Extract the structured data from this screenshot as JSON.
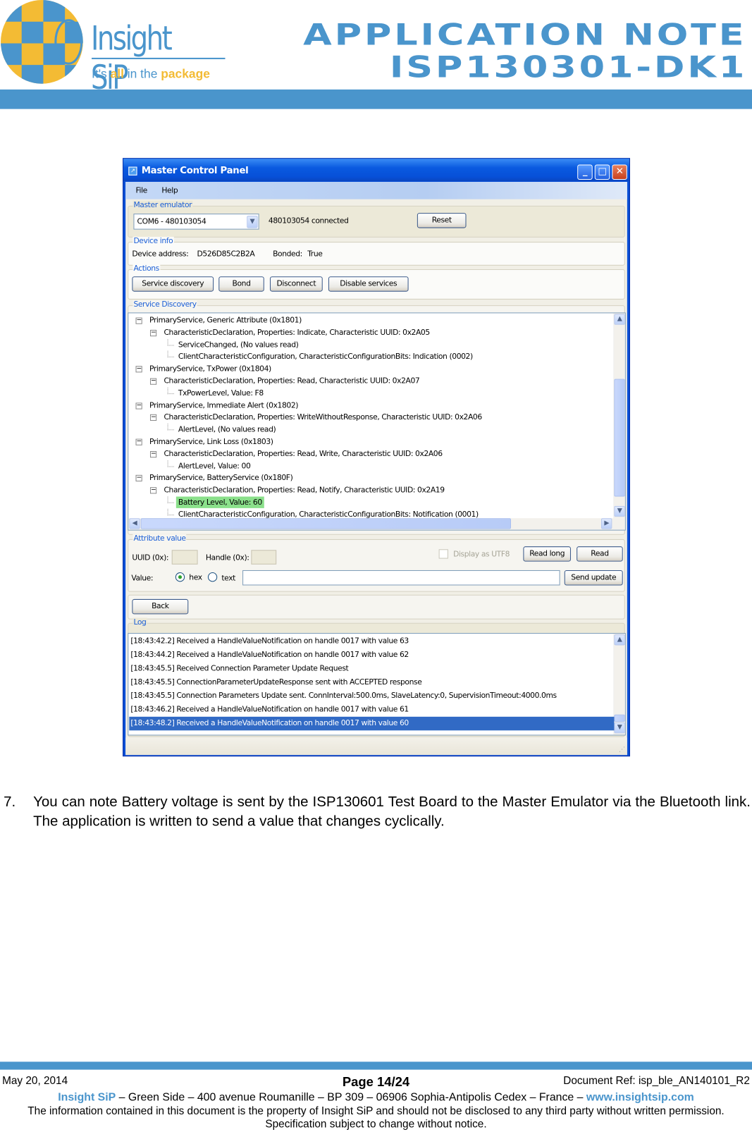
{
  "header": {
    "logo_text": "Insight SiP",
    "logo_tagline": [
      "It's ",
      "all",
      " in the ",
      "package"
    ],
    "title_line1": "APPLICATION NOTE",
    "title_line2": "ISP130301-DK1",
    "brand_color": "#4a95cc"
  },
  "window": {
    "title": "Master Control Panel",
    "controls": [
      "minimize",
      "maximize",
      "close"
    ],
    "menu": [
      "File",
      "Help"
    ],
    "master_emulator": {
      "label": "Master emulator",
      "com_port": "COM6 - 480103054",
      "status": "480103054 connected",
      "reset_label": "Reset"
    },
    "device_info": {
      "label": "Device info",
      "address_label": "Device address:",
      "address": "D526D85C2B2A",
      "bonded_label": "Bonded:",
      "bonded": "True"
    },
    "actions": {
      "label": "Actions",
      "buttons": [
        "Service discovery",
        "Bond",
        "Disconnect",
        "Disable services"
      ]
    },
    "service_discovery": {
      "label": "Service Discovery",
      "tree": [
        {
          "level": 0,
          "text": "PrimaryService, Generic Attribute (0x1801)"
        },
        {
          "level": 1,
          "text": "CharacteristicDeclaration, Properties: Indicate, Characteristic UUID: 0x2A05"
        },
        {
          "level": 2,
          "text": "ServiceChanged, (No values read)"
        },
        {
          "level": 2,
          "text": "ClientCharacteristicConfiguration, CharacteristicConfigurationBits: Indication (0002)"
        },
        {
          "level": 0,
          "text": "PrimaryService, TxPower (0x1804)"
        },
        {
          "level": 1,
          "text": "CharacteristicDeclaration, Properties: Read, Characteristic UUID: 0x2A07"
        },
        {
          "level": 2,
          "text": "TxPowerLevel, Value: F8"
        },
        {
          "level": 0,
          "text": "PrimaryService, Immediate Alert (0x1802)"
        },
        {
          "level": 1,
          "text": "CharacteristicDeclaration, Properties: WriteWithoutResponse, Characteristic UUID: 0x2A06"
        },
        {
          "level": 2,
          "text": "AlertLevel, (No values read)"
        },
        {
          "level": 0,
          "text": "PrimaryService, Link Loss (0x1803)"
        },
        {
          "level": 1,
          "text": "CharacteristicDeclaration, Properties: Read, Write, Characteristic UUID: 0x2A06"
        },
        {
          "level": 2,
          "text": "AlertLevel, Value: 00"
        },
        {
          "level": 0,
          "text": "PrimaryService, BatteryService (0x180F)"
        },
        {
          "level": 1,
          "text": "CharacteristicDeclaration, Properties: Read, Notify, Characteristic UUID: 0x2A19"
        },
        {
          "level": 2,
          "text": "Battery Level, Value: 60",
          "highlighted": true
        },
        {
          "level": 2,
          "text": "ClientCharacteristicConfiguration, CharacteristicConfigurationBits: Notification (0001)"
        }
      ],
      "highlight_color": "#8be08b"
    },
    "attribute_value": {
      "label": "Attribute value",
      "uuid_label": "UUID (0x):",
      "uuid_value": "",
      "handle_label": "Handle (0x):",
      "handle_value": "",
      "utf8_label": "Display as UTF8",
      "utf8_checked": false,
      "read_long_label": "Read long",
      "read_label": "Read",
      "value_label": "Value:",
      "hex_label": "hex",
      "text_label": "text",
      "selected_format": "hex",
      "value": "",
      "send_update_label": "Send update"
    },
    "back_label": "Back",
    "log": {
      "label": "Log",
      "entries": [
        "[18:43:42.2] Received a HandleValueNotification on handle 0017 with value 63",
        "[18:43:44.2] Received a HandleValueNotification on handle 0017 with value 62",
        "[18:43:45.5] Received Connection Parameter Update Request",
        "[18:43:45.5] ConnectionParameterUpdateResponse sent with ACCEPTED response",
        "[18:43:45.5] Connection Parameters Update sent. ConnInterval:500.0ms, SlaveLatency:0, SupervisionTimeout:4000.0ms",
        "[18:43:46.2] Received a HandleValueNotification on handle 0017 with value 61",
        "[18:43:48.2] Received a HandleValueNotification on handle 0017 with value 60"
      ],
      "selected_index": 6,
      "selection_color": "#316ac5"
    }
  },
  "body": {
    "item_number": "7.",
    "text": "You can note Battery voltage is sent by the ISP130601 Test Board to the Master Emulator via the Bluetooth link. The application is written to send a value that changes cyclically."
  },
  "footer": {
    "date": "May 20, 2014",
    "page": "Page 14/24",
    "doc_ref": "Document Ref: isp_ble_AN140101_R2",
    "company": "Insight SiP",
    "address": " – Green Side – 400 avenue Roumanille – BP 309 – 06906 Sophia-Antipolis Cedex – France – ",
    "website": "www.insightsip.com",
    "notice1": "The information contained in this document is the property of Insight SiP and should not be disclosed to any third party without written permission.",
    "notice2": "Specification subject to change without notice."
  }
}
